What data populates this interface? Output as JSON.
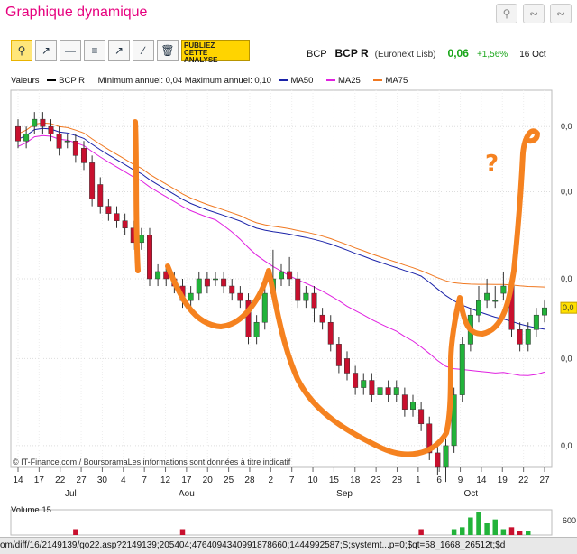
{
  "header": {
    "title": "Graphique dynamique",
    "icons": [
      "search-icon",
      "chart-icon",
      "chart-alt-icon"
    ]
  },
  "toolbar": {
    "buttons": [
      "zoom-icon",
      "trendline-icon",
      "horizontal-line-icon",
      "fibonacci-icon",
      "channel-icon",
      "parallel-icon",
      "delete-icon"
    ],
    "publiez_line1": "PUBLIEZ",
    "publiez_line2": "CETTE",
    "publiez_line3": "ANALYSE"
  },
  "quote": {
    "ticker": "BCP",
    "name": "BCP R",
    "exchange": "(Euronext Lisb)",
    "value": "0,06",
    "change": "+1,56%",
    "date": "16 Oct"
  },
  "legend": {
    "valeurs": "Valeurs",
    "series": "BCP R",
    "minmax": "Minimum annuel: 0,04 Maximum annuel: 0,10",
    "ma50": "MA50",
    "ma25": "MA25",
    "ma75": "MA75",
    "colors": {
      "series": "#000000",
      "ma50": "#1a22a8",
      "ma25": "#e020e0",
      "ma75": "#f07820"
    }
  },
  "chart_data": {
    "type": "candlestick",
    "x_ticks": [
      "14",
      "17",
      "22",
      "27",
      "30",
      "4",
      "7",
      "12",
      "17",
      "20",
      "25",
      "28",
      "2",
      "7",
      "10",
      "15",
      "18",
      "23",
      "28",
      "1",
      "6",
      "9",
      "14",
      "19",
      "22",
      "27"
    ],
    "month_labels": [
      "Jul",
      "Aou",
      "Sep",
      "Oct"
    ],
    "y_tick_labels": [
      "0,0",
      "0,0",
      "0,0",
      "0,0",
      "0,0",
      "0,0"
    ],
    "last_price_tag": "0,0",
    "candles": [
      [
        0.082,
        0.08,
        0.083,
        0.079
      ],
      [
        0.08,
        0.081,
        0.082,
        0.079
      ],
      [
        0.082,
        0.083,
        0.084,
        0.081
      ],
      [
        0.083,
        0.082,
        0.084,
        0.081
      ],
      [
        0.082,
        0.081,
        0.083,
        0.08
      ],
      [
        0.081,
        0.079,
        0.082,
        0.078
      ],
      [
        0.08,
        0.08,
        0.081,
        0.079
      ],
      [
        0.08,
        0.078,
        0.081,
        0.077
      ],
      [
        0.079,
        0.077,
        0.08,
        0.076
      ],
      [
        0.077,
        0.072,
        0.078,
        0.071
      ],
      [
        0.074,
        0.071,
        0.075,
        0.07
      ],
      [
        0.071,
        0.07,
        0.072,
        0.069
      ],
      [
        0.07,
        0.069,
        0.071,
        0.068
      ],
      [
        0.069,
        0.068,
        0.07,
        0.067
      ],
      [
        0.068,
        0.066,
        0.069,
        0.065
      ],
      [
        0.066,
        0.067,
        0.068,
        0.065
      ],
      [
        0.067,
        0.061,
        0.068,
        0.06
      ],
      [
        0.061,
        0.062,
        0.063,
        0.06
      ],
      [
        0.062,
        0.061,
        0.063,
        0.06
      ],
      [
        0.061,
        0.06,
        0.062,
        0.059
      ],
      [
        0.06,
        0.058,
        0.061,
        0.057
      ],
      [
        0.058,
        0.059,
        0.06,
        0.057
      ],
      [
        0.059,
        0.061,
        0.062,
        0.058
      ],
      [
        0.061,
        0.06,
        0.062,
        0.059
      ],
      [
        0.061,
        0.061,
        0.062,
        0.06
      ],
      [
        0.061,
        0.06,
        0.062,
        0.059
      ],
      [
        0.06,
        0.059,
        0.061,
        0.058
      ],
      [
        0.059,
        0.058,
        0.06,
        0.057
      ],
      [
        0.058,
        0.053,
        0.059,
        0.052
      ],
      [
        0.053,
        0.055,
        0.056,
        0.052
      ],
      [
        0.055,
        0.059,
        0.06,
        0.054
      ],
      [
        0.059,
        0.061,
        0.065,
        0.058
      ],
      [
        0.061,
        0.062,
        0.063,
        0.06
      ],
      [
        0.062,
        0.061,
        0.064,
        0.06
      ],
      [
        0.061,
        0.058,
        0.062,
        0.057
      ],
      [
        0.058,
        0.059,
        0.06,
        0.057
      ],
      [
        0.059,
        0.057,
        0.06,
        0.055
      ],
      [
        0.056,
        0.055,
        0.057,
        0.054
      ],
      [
        0.055,
        0.052,
        0.056,
        0.051
      ],
      [
        0.052,
        0.049,
        0.053,
        0.048
      ],
      [
        0.05,
        0.048,
        0.051,
        0.047
      ],
      [
        0.048,
        0.046,
        0.049,
        0.045
      ],
      [
        0.046,
        0.047,
        0.048,
        0.045
      ],
      [
        0.047,
        0.045,
        0.048,
        0.044
      ],
      [
        0.045,
        0.046,
        0.047,
        0.044
      ],
      [
        0.046,
        0.045,
        0.047,
        0.044
      ],
      [
        0.045,
        0.046,
        0.047,
        0.044
      ],
      [
        0.045,
        0.043,
        0.046,
        0.042
      ],
      [
        0.043,
        0.044,
        0.045,
        0.042
      ],
      [
        0.043,
        0.041,
        0.044,
        0.04
      ],
      [
        0.041,
        0.037,
        0.042,
        0.036
      ],
      [
        0.037,
        0.035,
        0.038,
        0.034
      ],
      [
        0.035,
        0.038,
        0.039,
        0.033
      ],
      [
        0.038,
        0.045,
        0.046,
        0.037
      ],
      [
        0.045,
        0.052,
        0.053,
        0.044
      ],
      [
        0.052,
        0.056,
        0.057,
        0.051
      ],
      [
        0.056,
        0.058,
        0.06,
        0.055
      ],
      [
        0.058,
        0.059,
        0.061,
        0.057
      ],
      [
        0.058,
        0.058,
        0.06,
        0.057
      ],
      [
        0.059,
        0.06,
        0.062,
        0.058
      ],
      [
        0.06,
        0.054,
        0.061,
        0.053
      ],
      [
        0.054,
        0.052,
        0.055,
        0.051
      ],
      [
        0.052,
        0.054,
        0.055,
        0.051
      ],
      [
        0.054,
        0.056,
        0.057,
        0.053
      ],
      [
        0.056,
        0.057,
        0.058,
        0.055
      ]
    ],
    "ylim": [
      0.035,
      0.087
    ],
    "volume_label": "Volume 15",
    "volume_tick": "600",
    "volume": [
      0,
      0,
      0,
      0,
      0,
      0,
      0,
      3,
      0,
      0,
      0,
      0,
      0,
      0,
      0,
      0,
      0,
      0,
      0,
      0,
      3,
      0,
      0,
      0,
      0,
      0,
      0,
      0,
      0,
      0,
      0,
      0,
      0,
      0,
      0,
      0,
      0,
      0,
      0,
      0,
      0,
      0,
      0,
      0,
      0,
      0,
      0,
      0,
      0,
      3,
      0,
      0,
      0,
      3,
      4,
      9,
      12,
      6,
      8,
      3,
      4,
      2,
      2,
      0,
      0
    ]
  },
  "credit": "© IT-Finance.com / BoursoramaLes informations sont données à titre indicatif",
  "status_url": "om/diff/16/2149139/go22.asp?2149139;205404;4764094340991878660;1444992587;S;systemt...p=0;$qt=58_1668_26512t;$d"
}
